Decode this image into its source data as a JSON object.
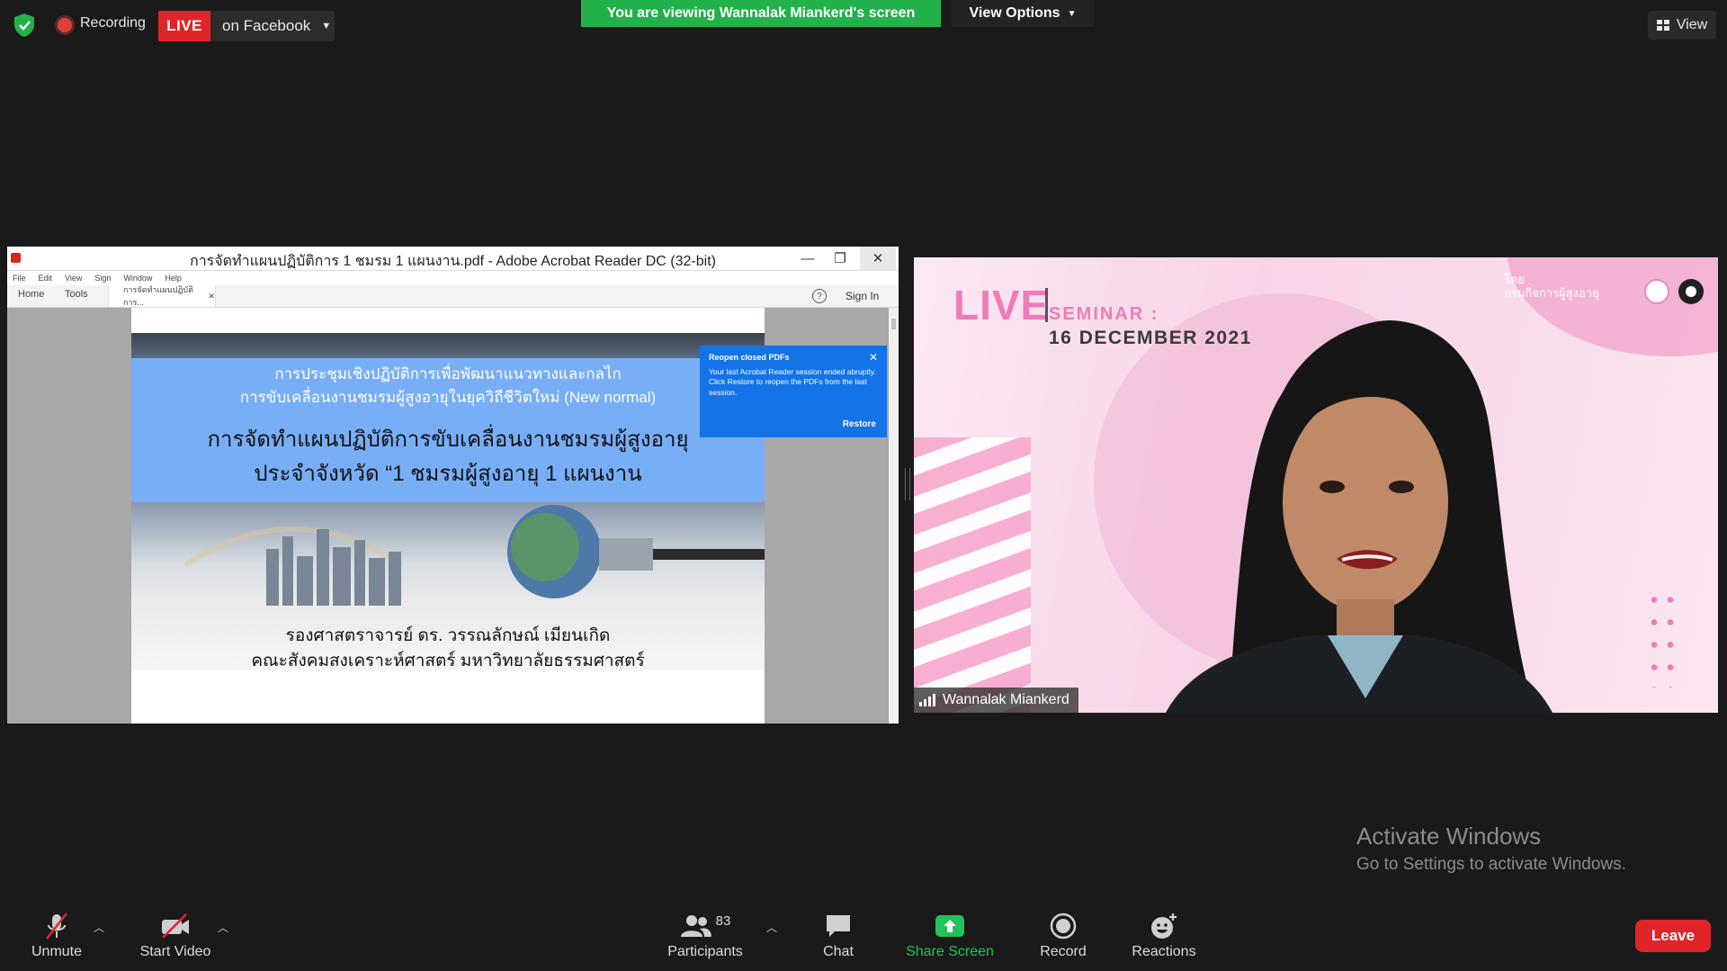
{
  "top_bar": {
    "recording_label": "Recording",
    "live_badge": "LIVE",
    "stream_target": "on Facebook",
    "viewing_banner": "You are viewing Wannalak Miankerd's screen",
    "view_options": "View Options",
    "view_button": "View"
  },
  "shared_screen": {
    "window_title": "การจัดทำแผนปฏิบัติการ 1 ชมรม 1 แผนงาน.pdf - Adobe Acrobat Reader DC (32-bit)",
    "menu": [
      "File",
      "Edit",
      "View",
      "Sign",
      "Window",
      "Help"
    ],
    "tabs": {
      "home": "Home",
      "tools": "Tools",
      "doc_tab": "การจัดทำแผนปฏิบัติการ...",
      "sign_in": "Sign In"
    },
    "pdf": {
      "subtitle_line1": "การประชุมเชิงปฏิบัติการเพื่อพัฒนาแนวทางและกลไก",
      "subtitle_line2": "การขับเคลื่อนงานชมรมผู้สูงอายุในยุควิถีชีวิตใหม่ (New normal)",
      "title_line1": "การจัดทำแผนปฏิบัติการขับเคลื่อนงานชมรมผู้สูงอายุ",
      "title_line2": "ประจำจังหวัด “1 ชมรมผู้สูงอายุ 1 แผนงาน",
      "author": "รองศาสตราจารย์ ดร. วรรณลักษณ์ เมียนเกิด",
      "affiliation": "คณะสังคมสงเคราะห์ศาสตร์ มหาวิทยาลัยธรรมศาสตร์"
    },
    "notification": {
      "title": "Reopen closed PDFs",
      "body": "Your last Acrobat Reader session ended abruptly. Click Restore to reopen the PDFs from the last session.",
      "action": "Restore"
    }
  },
  "video": {
    "live_text": "LIVE",
    "seminar_text": "SEMINAR :",
    "date_text": "16 DECEMBER 2021",
    "org_line1": "โดย",
    "org_line2": "กรมกิจการผู้สูงอายุ",
    "participant_name": "Wannalak Miankerd"
  },
  "watermark": {
    "title": "Activate Windows",
    "subtitle": "Go to Settings to activate Windows."
  },
  "toolbar": {
    "unmute": "Unmute",
    "start_video": "Start Video",
    "participants": "Participants",
    "participant_count": "83",
    "chat": "Chat",
    "share_screen": "Share Screen",
    "record": "Record",
    "reactions": "Reactions",
    "leave": "Leave"
  },
  "colors": {
    "live_red": "#e0252a",
    "banner_green": "#23b14b",
    "share_green": "#23c15a",
    "acrobat_blue": "#1473e6",
    "slide_blue": "#78aef5",
    "seminar_pink": "#f07bb8"
  }
}
